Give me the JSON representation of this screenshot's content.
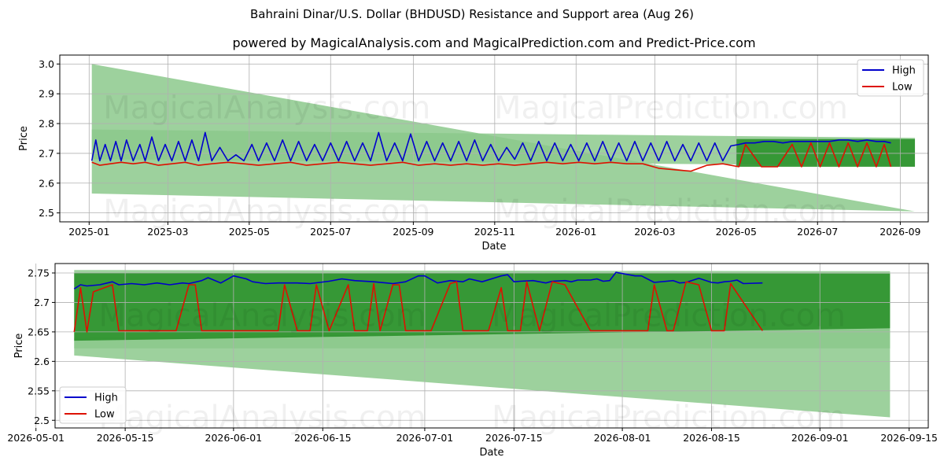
{
  "title": "Bahraini Dinar/U.S. Dollar (BHDUSD) Resistance and Support area (Aug 26)",
  "subtitle": "powered by MagicalAnalysis.com and MagicalPrediction.com and Predict-Price.com",
  "watermarks": [
    "MagicalAnalysis.com",
    "MagicalPrediction.com"
  ],
  "colors": {
    "high": "#0000cc",
    "low": "#dd1100",
    "band_light": "#8cc98c",
    "band_dark": "#2e922e"
  },
  "chart_data": [
    {
      "type": "line",
      "xlabel": "Date",
      "ylabel": "Price",
      "xlim": [
        "2024-12-10",
        "2026-09-22"
      ],
      "ylim": [
        2.47,
        3.03
      ],
      "x_ticks": [
        "2025-01",
        "2025-03",
        "2025-05",
        "2025-07",
        "2025-09",
        "2025-11",
        "2026-01",
        "2026-03",
        "2026-05",
        "2026-07",
        "2026-09"
      ],
      "y_ticks": [
        2.5,
        2.6,
        2.7,
        2.8,
        2.9,
        3.0
      ],
      "legend": "top-right",
      "grid": true,
      "bands": [
        {
          "x": [
            "2025-01-03",
            "2026-09-12"
          ],
          "upper": [
            3.0,
            2.505
          ],
          "lower": [
            2.565,
            2.505
          ],
          "shade": "light"
        },
        {
          "x": [
            "2025-01-03",
            "2026-09-12"
          ],
          "upper": [
            2.78,
            2.752
          ],
          "lower": [
            2.68,
            2.658
          ],
          "shade": "light"
        },
        {
          "x": [
            "2026-05-01",
            "2026-09-12"
          ],
          "upper": [
            2.748,
            2.748
          ],
          "lower": [
            2.655,
            2.655
          ],
          "shade": "dark"
        }
      ],
      "series": [
        {
          "name": "High",
          "x": [
            "2025-01-03",
            "2025-01-06",
            "2025-01-09",
            "2025-01-13",
            "2025-01-17",
            "2025-01-21",
            "2025-01-25",
            "2025-01-29",
            "2025-02-03",
            "2025-02-08",
            "2025-02-12",
            "2025-02-17",
            "2025-02-22",
            "2025-02-27",
            "2025-03-04",
            "2025-03-09",
            "2025-03-14",
            "2025-03-19",
            "2025-03-24",
            "2025-03-29",
            "2025-04-03",
            "2025-04-09",
            "2025-04-15",
            "2025-04-21",
            "2025-04-27",
            "2025-05-03",
            "2025-05-08",
            "2025-05-14",
            "2025-05-20",
            "2025-05-26",
            "2025-06-01",
            "2025-06-07",
            "2025-06-13",
            "2025-06-19",
            "2025-06-25",
            "2025-07-01",
            "2025-07-07",
            "2025-07-13",
            "2025-07-19",
            "2025-07-25",
            "2025-07-31",
            "2025-08-06",
            "2025-08-12",
            "2025-08-18",
            "2025-08-24",
            "2025-08-30",
            "2025-09-05",
            "2025-09-11",
            "2025-09-17",
            "2025-09-23",
            "2025-09-29",
            "2025-10-05",
            "2025-10-11",
            "2025-10-17",
            "2025-10-23",
            "2025-10-29",
            "2025-11-04",
            "2025-11-10",
            "2025-11-16",
            "2025-11-22",
            "2025-11-28",
            "2025-12-04",
            "2025-12-10",
            "2025-12-16",
            "2025-12-22",
            "2025-12-28",
            "2026-01-03",
            "2026-01-09",
            "2026-01-15",
            "2026-01-21",
            "2026-01-27",
            "2026-02-02",
            "2026-02-08",
            "2026-02-14",
            "2026-02-20",
            "2026-02-26",
            "2026-03-04",
            "2026-03-10",
            "2026-03-16",
            "2026-03-22",
            "2026-03-28",
            "2026-04-03",
            "2026-04-09",
            "2026-04-15",
            "2026-04-21",
            "2026-04-27",
            "2026-05-03",
            "2026-05-08",
            "2026-05-15",
            "2026-05-22",
            "2026-05-29",
            "2026-06-05",
            "2026-06-12",
            "2026-06-19",
            "2026-06-26",
            "2026-07-03",
            "2026-07-10",
            "2026-07-17",
            "2026-07-24",
            "2026-07-31",
            "2026-08-07",
            "2026-08-14",
            "2026-08-20",
            "2026-08-25"
          ],
          "values": [
            2.675,
            2.745,
            2.675,
            2.73,
            2.675,
            2.74,
            2.675,
            2.745,
            2.675,
            2.73,
            2.675,
            2.755,
            2.675,
            2.73,
            2.675,
            2.74,
            2.675,
            2.745,
            2.675,
            2.77,
            2.675,
            2.72,
            2.675,
            2.695,
            2.675,
            2.73,
            2.675,
            2.735,
            2.675,
            2.745,
            2.675,
            2.74,
            2.675,
            2.73,
            2.675,
            2.735,
            2.675,
            2.74,
            2.675,
            2.735,
            2.675,
            2.77,
            2.675,
            2.735,
            2.675,
            2.765,
            2.675,
            2.74,
            2.675,
            2.735,
            2.675,
            2.74,
            2.675,
            2.745,
            2.675,
            2.73,
            2.675,
            2.72,
            2.68,
            2.735,
            2.675,
            2.74,
            2.675,
            2.735,
            2.675,
            2.73,
            2.675,
            2.735,
            2.675,
            2.74,
            2.675,
            2.735,
            2.675,
            2.74,
            2.675,
            2.735,
            2.675,
            2.74,
            2.675,
            2.73,
            2.675,
            2.735,
            2.675,
            2.735,
            2.675,
            2.725,
            2.73,
            2.735,
            2.735,
            2.74,
            2.74,
            2.735,
            2.74,
            2.74,
            2.74,
            2.74,
            2.74,
            2.745,
            2.745,
            2.74,
            2.745,
            2.74,
            2.74,
            2.735
          ]
        },
        {
          "name": "Low",
          "x": [
            "2025-01-03",
            "2025-01-09",
            "2025-01-17",
            "2025-01-25",
            "2025-02-03",
            "2025-02-12",
            "2025-02-22",
            "2025-03-04",
            "2025-03-14",
            "2025-03-24",
            "2025-04-03",
            "2025-04-15",
            "2025-04-27",
            "2025-05-08",
            "2025-05-20",
            "2025-06-01",
            "2025-06-13",
            "2025-06-25",
            "2025-07-07",
            "2025-07-19",
            "2025-07-31",
            "2025-08-12",
            "2025-08-24",
            "2025-09-05",
            "2025-09-17",
            "2025-09-29",
            "2025-10-11",
            "2025-10-23",
            "2025-11-04",
            "2025-11-16",
            "2025-11-28",
            "2025-12-10",
            "2025-12-22",
            "2026-01-03",
            "2026-01-15",
            "2026-01-27",
            "2026-02-08",
            "2026-02-20",
            "2026-03-04",
            "2026-03-16",
            "2026-03-28",
            "2026-04-09",
            "2026-04-21",
            "2026-05-03",
            "2026-05-08",
            "2026-05-20",
            "2026-06-01",
            "2026-06-12",
            "2026-06-19",
            "2026-06-26",
            "2026-07-03",
            "2026-07-10",
            "2026-07-17",
            "2026-07-24",
            "2026-07-31",
            "2026-08-07",
            "2026-08-14",
            "2026-08-20",
            "2026-08-25"
          ],
          "values": [
            2.67,
            2.66,
            2.665,
            2.67,
            2.665,
            2.67,
            2.66,
            2.665,
            2.67,
            2.66,
            2.665,
            2.67,
            2.665,
            2.66,
            2.665,
            2.67,
            2.66,
            2.665,
            2.67,
            2.665,
            2.66,
            2.665,
            2.67,
            2.66,
            2.665,
            2.66,
            2.665,
            2.66,
            2.665,
            2.66,
            2.665,
            2.67,
            2.665,
            2.67,
            2.665,
            2.67,
            2.665,
            2.665,
            2.65,
            2.645,
            2.64,
            2.66,
            2.665,
            2.655,
            2.73,
            2.655,
            2.655,
            2.73,
            2.655,
            2.735,
            2.655,
            2.735,
            2.655,
            2.735,
            2.655,
            2.735,
            2.655,
            2.73,
            2.655
          ]
        }
      ]
    },
    {
      "type": "line",
      "xlabel": "Date",
      "ylabel": "Price",
      "xlim": [
        "2026-05-04",
        "2026-09-18"
      ],
      "ylim": [
        2.487,
        2.766
      ],
      "x_ticks": [
        "2026-05-01",
        "2026-05-15",
        "2026-06-01",
        "2026-06-15",
        "2026-07-01",
        "2026-07-15",
        "2026-08-01",
        "2026-08-15",
        "2026-09-01",
        "2026-09-15"
      ],
      "y_ticks": [
        2.5,
        2.55,
        2.6,
        2.65,
        2.7,
        2.75
      ],
      "legend": "bottom-left",
      "grid": true,
      "bands": [
        {
          "x": [
            "2026-05-07",
            "2026-09-12"
          ],
          "upper": [
            2.64,
            2.655
          ],
          "lower": [
            2.61,
            2.505
          ],
          "shade": "light"
        },
        {
          "x": [
            "2026-05-07",
            "2026-09-12"
          ],
          "upper": [
            2.755,
            2.753
          ],
          "lower": [
            2.622,
            2.622
          ],
          "shade": "light"
        },
        {
          "x": [
            "2026-05-07",
            "2026-09-12"
          ],
          "upper": [
            2.75,
            2.749
          ],
          "lower": [
            2.635,
            2.656
          ],
          "shade": "dark"
        }
      ],
      "series": [
        {
          "name": "High",
          "x": [
            "2026-05-07",
            "2026-05-08",
            "2026-05-09",
            "2026-05-11",
            "2026-05-13",
            "2026-05-14",
            "2026-05-16",
            "2026-05-18",
            "2026-05-20",
            "2026-05-22",
            "2026-05-24",
            "2026-05-25",
            "2026-05-27",
            "2026-05-28",
            "2026-05-30",
            "2026-06-01",
            "2026-06-03",
            "2026-06-04",
            "2026-06-06",
            "2026-06-08",
            "2026-06-10",
            "2026-06-11",
            "2026-06-13",
            "2026-06-16",
            "2026-06-18",
            "2026-06-20",
            "2026-06-23",
            "2026-06-25",
            "2026-06-26",
            "2026-06-28",
            "2026-06-30",
            "2026-07-01",
            "2026-07-03",
            "2026-07-05",
            "2026-07-07",
            "2026-07-08",
            "2026-07-10",
            "2026-07-13",
            "2026-07-14",
            "2026-07-15",
            "2026-07-16",
            "2026-07-18",
            "2026-07-20",
            "2026-07-21",
            "2026-07-23",
            "2026-07-24",
            "2026-07-25",
            "2026-07-27",
            "2026-07-28",
            "2026-07-29",
            "2026-07-30",
            "2026-07-31",
            "2026-08-03",
            "2026-08-04",
            "2026-08-06",
            "2026-08-09",
            "2026-08-10",
            "2026-08-11",
            "2026-08-13",
            "2026-08-15",
            "2026-08-16",
            "2026-08-17",
            "2026-08-18",
            "2026-08-19",
            "2026-08-20",
            "2026-08-23"
          ],
          "values": [
            2.723,
            2.73,
            2.728,
            2.73,
            2.735,
            2.73,
            2.732,
            2.73,
            2.733,
            2.73,
            2.733,
            2.732,
            2.737,
            2.742,
            2.733,
            2.745,
            2.74,
            2.735,
            2.732,
            2.733,
            2.733,
            2.733,
            2.732,
            2.736,
            2.74,
            2.737,
            2.735,
            2.733,
            2.732,
            2.735,
            2.745,
            2.745,
            2.733,
            2.737,
            2.735,
            2.74,
            2.735,
            2.745,
            2.747,
            2.735,
            2.736,
            2.737,
            2.733,
            2.736,
            2.737,
            2.735,
            2.738,
            2.738,
            2.74,
            2.736,
            2.737,
            2.751,
            2.745,
            2.745,
            2.734,
            2.737,
            2.733,
            2.734,
            2.741,
            2.734,
            2.733,
            2.735,
            2.736,
            2.738,
            2.732,
            2.733
          ]
        },
        {
          "name": "Low",
          "x": [
            "2026-05-07",
            "2026-05-08",
            "2026-05-09",
            "2026-05-10",
            "2026-05-13",
            "2026-05-14",
            "2026-05-20",
            "2026-05-23",
            "2026-05-25",
            "2026-05-26",
            "2026-05-27",
            "2026-06-06",
            "2026-06-08",
            "2026-06-09",
            "2026-06-11",
            "2026-06-13",
            "2026-06-14",
            "2026-06-16",
            "2026-06-19",
            "2026-06-20",
            "2026-06-22",
            "2026-06-23",
            "2026-06-24",
            "2026-06-26",
            "2026-06-27",
            "2026-06-28",
            "2026-06-30",
            "2026-07-01",
            "2026-07-02",
            "2026-07-05",
            "2026-07-06",
            "2026-07-07",
            "2026-07-10",
            "2026-07-11",
            "2026-07-13",
            "2026-07-14",
            "2026-07-16",
            "2026-07-17",
            "2026-07-19",
            "2026-07-21",
            "2026-07-23",
            "2026-07-27",
            "2026-07-30",
            "2026-08-02",
            "2026-08-04",
            "2026-08-05",
            "2026-08-06",
            "2026-08-08",
            "2026-08-09",
            "2026-08-11",
            "2026-08-13",
            "2026-08-15",
            "2026-08-16",
            "2026-08-17",
            "2026-08-18",
            "2026-08-23"
          ],
          "values": [
            2.65,
            2.725,
            2.65,
            2.718,
            2.73,
            2.652,
            2.652,
            2.652,
            2.73,
            2.73,
            2.652,
            2.652,
            2.652,
            2.73,
            2.652,
            2.652,
            2.73,
            2.652,
            2.73,
            2.652,
            2.652,
            2.732,
            2.652,
            2.73,
            2.73,
            2.652,
            2.652,
            2.652,
            2.652,
            2.732,
            2.735,
            2.652,
            2.652,
            2.652,
            2.725,
            2.652,
            2.652,
            2.735,
            2.652,
            2.735,
            2.73,
            2.652,
            2.652,
            2.652,
            2.652,
            2.652,
            2.73,
            2.652,
            2.652,
            2.735,
            2.73,
            2.652,
            2.652,
            2.652,
            2.732,
            2.652
          ]
        }
      ]
    }
  ]
}
